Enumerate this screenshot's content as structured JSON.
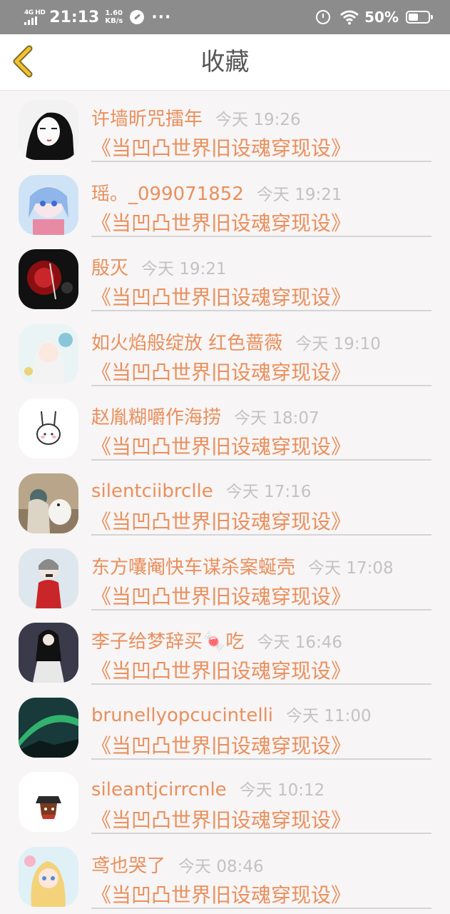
{
  "status_bar": {
    "network": "4G HD",
    "time": "21:13",
    "speed_value": "1.60",
    "speed_unit": "KB/s",
    "more": "···",
    "battery_percent": "50%",
    "battery_level": 0.5
  },
  "header": {
    "title": "收藏",
    "back_icon": "chevron-left-icon",
    "accent_color": "#f2c230"
  },
  "colors": {
    "name": "#ea8f5c",
    "time": "#c3c3c3",
    "background": "#f7f5f5"
  },
  "items": [
    {
      "name": "许墙昕咒擂年",
      "time": "今天 19:26",
      "novel": "《当凹凸世界旧设魂穿现设》"
    },
    {
      "name": "瑶。_099071852",
      "time": "今天 19:21",
      "novel": "《当凹凸世界旧设魂穿现设》"
    },
    {
      "name": "殷灭",
      "time": "今天 19:21",
      "novel": "《当凹凸世界旧设魂穿现设》"
    },
    {
      "name": "如火焰般绽放 红色蔷薇",
      "time": "今天 19:10",
      "novel": "《当凹凸世界旧设魂穿现设》"
    },
    {
      "name": "赵胤糊嚼作海捞",
      "time": "今天 18:07",
      "novel": "《当凹凸世界旧设魂穿现设》"
    },
    {
      "name": "silentciibrclle",
      "time": "今天 17:16",
      "novel": "《当凹凸世界旧设魂穿现设》"
    },
    {
      "name": "东方囔阉快车谋杀案蜒壳",
      "time": "今天 17:08",
      "novel": "《当凹凸世界旧设魂穿现设》"
    },
    {
      "name": "李子给梦辞买🍬吃",
      "time": "今天 16:46",
      "novel": "《当凹凸世界旧设魂穿现设》"
    },
    {
      "name": "brunellyopcucintelli",
      "time": "今天 11:00",
      "novel": "《当凹凸世界旧设魂穿现设》"
    },
    {
      "name": "sileantjcirrcnle",
      "time": "今天 10:12",
      "novel": "《当凹凸世界旧设魂穿现设》"
    },
    {
      "name": "鸢也哭了",
      "time": "今天 08:46",
      "novel": "《当凹凸世界旧设魂穿现设》"
    }
  ]
}
